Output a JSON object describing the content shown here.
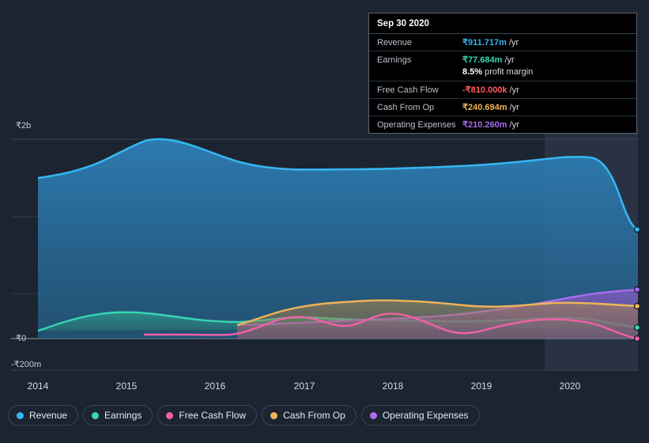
{
  "chart_data": {
    "type": "area",
    "title": "",
    "xlabel": "",
    "ylabel": "",
    "x_tick_labels": [
      "2014",
      "2015",
      "2016",
      "2017",
      "2018",
      "2019",
      "2020"
    ],
    "y_tick_labels": [
      "₹2b",
      "₹0",
      "-₹200m"
    ],
    "ylim": [
      -200000000,
      2000000000
    ],
    "grid": true,
    "legend_position": "bottom-left",
    "series": [
      {
        "name": "Revenue",
        "color": "#35b6f0",
        "x": [
          "2014.0",
          "2014.5",
          "2015.0",
          "2015.25",
          "2015.5",
          "2016.0",
          "2016.5",
          "2017.0",
          "2017.5",
          "2018.0",
          "2018.5",
          "2019.0",
          "2019.5",
          "2020.0",
          "2020.25",
          "2020.5",
          "2020.75"
        ],
        "values": [
          1380000000,
          1470000000,
          1860000000,
          1900000000,
          1880000000,
          1720000000,
          1640000000,
          1610000000,
          1610000000,
          1615000000,
          1620000000,
          1630000000,
          1660000000,
          1740000000,
          1720000000,
          1300000000,
          911717000
        ]
      },
      {
        "name": "Earnings",
        "color": "#38d6b4",
        "x": [
          "2014.0",
          "2014.5",
          "2015.0",
          "2015.5",
          "2016.0",
          "2016.5",
          "2017.0",
          "2017.5",
          "2018.0",
          "2018.5",
          "2019.0",
          "2019.5",
          "2020.0",
          "2020.5",
          "2020.75"
        ],
        "values": [
          55000000,
          110000000,
          150000000,
          165000000,
          150000000,
          120000000,
          130000000,
          150000000,
          140000000,
          125000000,
          120000000,
          130000000,
          140000000,
          110000000,
          77684000
        ]
      },
      {
        "name": "Free Cash Flow",
        "color": "#f060a8",
        "x": [
          "2015.0",
          "2015.5",
          "2016.0",
          "2016.5",
          "2017.0",
          "2017.5",
          "2018.0",
          "2018.5",
          "2019.0",
          "2019.5",
          "2020.0",
          "2020.5",
          "2020.75"
        ],
        "values": [
          -20000000,
          -15000000,
          -10000000,
          60000000,
          120000000,
          75000000,
          130000000,
          60000000,
          40000000,
          100000000,
          100000000,
          20000000,
          -810000
        ]
      },
      {
        "name": "Cash From Op",
        "color": "#f0b457",
        "x": [
          "2016.25",
          "2016.5",
          "2017.0",
          "2017.5",
          "2018.0",
          "2018.5",
          "2019.0",
          "2019.5",
          "2020.0",
          "2020.5",
          "2020.75"
        ],
        "values": [
          120000000,
          180000000,
          230000000,
          250000000,
          270000000,
          255000000,
          235000000,
          250000000,
          260000000,
          245000000,
          240694000
        ]
      },
      {
        "name": "Operating Expenses",
        "color": "#a96cf0",
        "x": [
          "2016.25",
          "2016.5",
          "2017.0",
          "2017.5",
          "2018.0",
          "2018.5",
          "2019.0",
          "2019.5",
          "2020.0",
          "2020.5",
          "2020.75"
        ],
        "values": [
          85000000,
          88000000,
          90000000,
          95000000,
          100000000,
          108000000,
          118000000,
          135000000,
          160000000,
          195000000,
          210260000
        ]
      }
    ]
  },
  "legend": {
    "items": [
      {
        "label": "Revenue",
        "color": "#35b6f0"
      },
      {
        "label": "Earnings",
        "color": "#38d6b4"
      },
      {
        "label": "Free Cash Flow",
        "color": "#f060a8"
      },
      {
        "label": "Cash From Op",
        "color": "#f0b457"
      },
      {
        "label": "Operating Expenses",
        "color": "#a96cf0"
      }
    ]
  },
  "tooltip": {
    "date": "Sep 30 2020",
    "rows": [
      {
        "label": "Revenue",
        "value": "₹911.717m",
        "unit": "/yr",
        "color": "#35b6f0"
      },
      {
        "label": "Earnings",
        "value": "₹77.684m",
        "unit": "/yr",
        "color": "#38d6b4"
      },
      {
        "label": "Free Cash Flow",
        "value": "-₹810.000k",
        "unit": "/yr",
        "color": "#ff5e5e"
      },
      {
        "label": "Cash From Op",
        "value": "₹240.694m",
        "unit": "/yr",
        "color": "#f0b457"
      },
      {
        "label": "Operating Expenses",
        "value": "₹210.260m",
        "unit": "/yr",
        "color": "#a96cf0"
      }
    ],
    "margin_value": "8.5%",
    "margin_label": "profit margin"
  },
  "axis": {
    "y_top": "₹2b",
    "y_zero": "₹0",
    "y_bottom": "-₹200m",
    "x": [
      "2014",
      "2015",
      "2016",
      "2017",
      "2018",
      "2019",
      "2020"
    ]
  }
}
